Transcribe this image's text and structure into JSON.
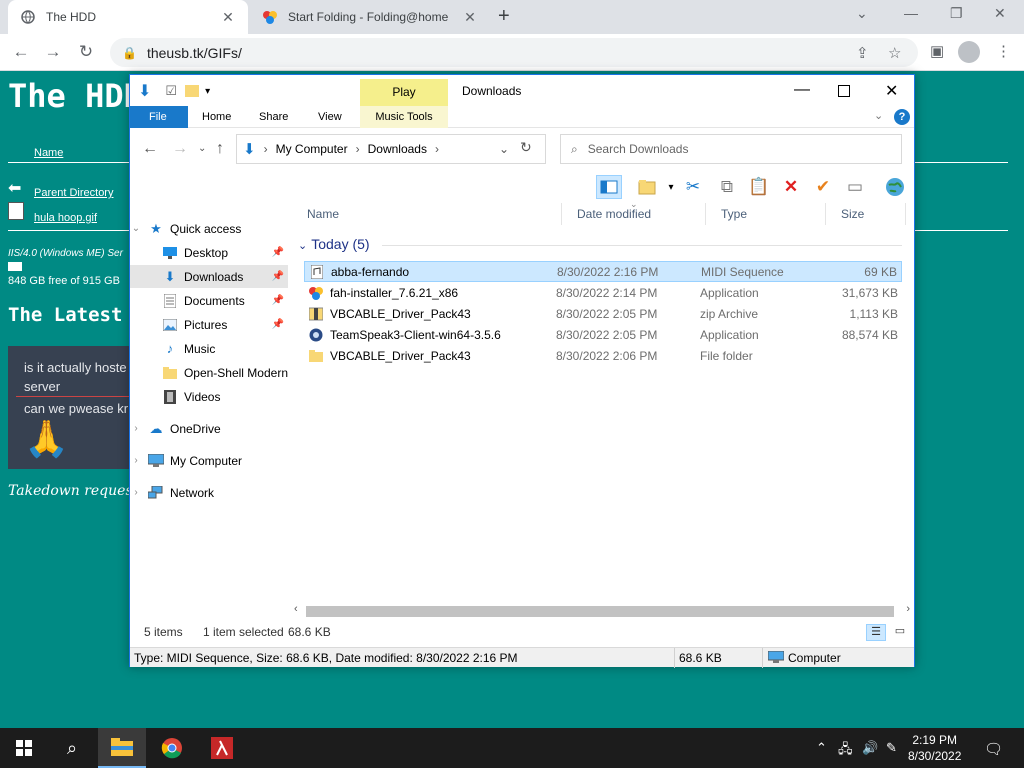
{
  "browser": {
    "tabs": [
      {
        "title": "The HDD"
      },
      {
        "title": "Start Folding - Folding@home"
      }
    ],
    "url": "theusb.tk/GIFs/"
  },
  "page": {
    "heading": "The HDD",
    "name_col": "Name",
    "links": [
      {
        "label": "Parent Directory"
      },
      {
        "label": "hula hoop.gif"
      }
    ],
    "server_info": "IIS/4.0 (Windows ME) Ser",
    "disk": "848 GB free of 915 GB",
    "latest_heading": "The Latest M",
    "chat": [
      "is it actually hoste server",
      "can we pwease kr"
    ],
    "takedown": "Takedown requests"
  },
  "explorer": {
    "title": "Downloads",
    "context_tab": "Play",
    "ribbon_tabs": [
      "File",
      "Home",
      "Share",
      "View",
      "Music Tools"
    ],
    "breadcrumb": [
      "My Computer",
      "Downloads"
    ],
    "search_placeholder": "Search Downloads",
    "nav": [
      {
        "label": "Quick access",
        "icon": "star-icon"
      },
      {
        "label": "Desktop",
        "icon": "desktop-icon",
        "pinned": true
      },
      {
        "label": "Downloads",
        "icon": "download-icon",
        "pinned": true
      },
      {
        "label": "Documents",
        "icon": "documents-icon",
        "pinned": true
      },
      {
        "label": "Pictures",
        "icon": "pictures-icon",
        "pinned": true
      },
      {
        "label": "Music",
        "icon": "music-icon"
      },
      {
        "label": "Open-Shell Modern",
        "icon": "folder-icon"
      },
      {
        "label": "Videos",
        "icon": "videos-icon"
      },
      {
        "label": "OneDrive",
        "icon": "cloud-icon"
      },
      {
        "label": "My Computer",
        "icon": "computer-icon"
      },
      {
        "label": "Network",
        "icon": "network-icon"
      }
    ],
    "columns": [
      "Name",
      "Date modified",
      "Type",
      "Size"
    ],
    "group": "Today (5)",
    "files": [
      {
        "name": "abba-fernando",
        "date": "8/30/2022 2:16 PM",
        "type": "MIDI Sequence",
        "size": "69 KB",
        "icon": "midi-file-icon"
      },
      {
        "name": "fah-installer_7.6.21_x86",
        "date": "8/30/2022 2:14 PM",
        "type": "Application",
        "size": "31,673 KB",
        "icon": "installer-icon"
      },
      {
        "name": "VBCABLE_Driver_Pack43",
        "date": "8/30/2022 2:05 PM",
        "type": "zip Archive",
        "size": "1,113 KB",
        "icon": "zip-icon"
      },
      {
        "name": "TeamSpeak3-Client-win64-3.5.6",
        "date": "8/30/2022 2:05 PM",
        "type": "Application",
        "size": "88,574 KB",
        "icon": "teamspeak-icon"
      },
      {
        "name": "VBCABLE_Driver_Pack43",
        "date": "8/30/2022 2:06 PM",
        "type": "File folder",
        "size": "",
        "icon": "folder-icon"
      }
    ],
    "status": {
      "items": "5 items",
      "selected": "1 item selected",
      "selected_size": "68.6 KB"
    },
    "details": {
      "info": "Type: MIDI Sequence, Size: 68.6 KB, Date modified: 8/30/2022 2:16 PM",
      "size": "68.6 KB",
      "location": "Computer"
    }
  },
  "taskbar": {
    "time": "2:19 PM",
    "date": "8/30/2022"
  },
  "colors": {
    "page_bg": "#008a84",
    "accent": "#1979ca",
    "selection": "#cce8ff"
  }
}
